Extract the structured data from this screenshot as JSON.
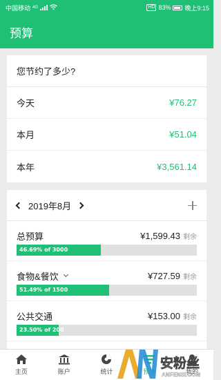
{
  "statusbar": {
    "carrier": "中国移动",
    "signal": "4G",
    "battery": "83%",
    "time": "晚上9:15"
  },
  "appbar": {
    "title": "预算"
  },
  "savings": {
    "title": "您节约了多少?",
    "rows": [
      {
        "label": "今天",
        "amount": "¥76.27"
      },
      {
        "label": "本月",
        "amount": "¥51.04"
      },
      {
        "label": "本年",
        "amount": "¥3,561.14"
      }
    ]
  },
  "budget": {
    "month": "2019年8月",
    "remaining_label": "剩余",
    "items": [
      {
        "name": "总预算",
        "amount": "¥1,599.43",
        "progress_text": "46.69% of 3000",
        "percent": 46.69
      },
      {
        "name": "食物&餐饮",
        "amount": "¥727.59",
        "progress_text": "51.49% of 1500",
        "percent": 51.49
      },
      {
        "name": "公共交通",
        "amount": "¥153.00",
        "progress_text": "23.50% of 200",
        "percent": 23.5
      }
    ]
  },
  "nav": {
    "items": [
      {
        "label": "主页",
        "icon": "home-icon"
      },
      {
        "label": "账户",
        "icon": "bank-icon"
      },
      {
        "label": "统计",
        "icon": "pie-chart-icon"
      },
      {
        "label": "预算",
        "icon": "budget-icon"
      },
      {
        "label": "我的",
        "icon": "user-icon"
      }
    ]
  },
  "watermark": {
    "text": "安粉丝",
    "sub": "ANFENSI.COM"
  },
  "colors": {
    "accent": "#1fc076"
  }
}
